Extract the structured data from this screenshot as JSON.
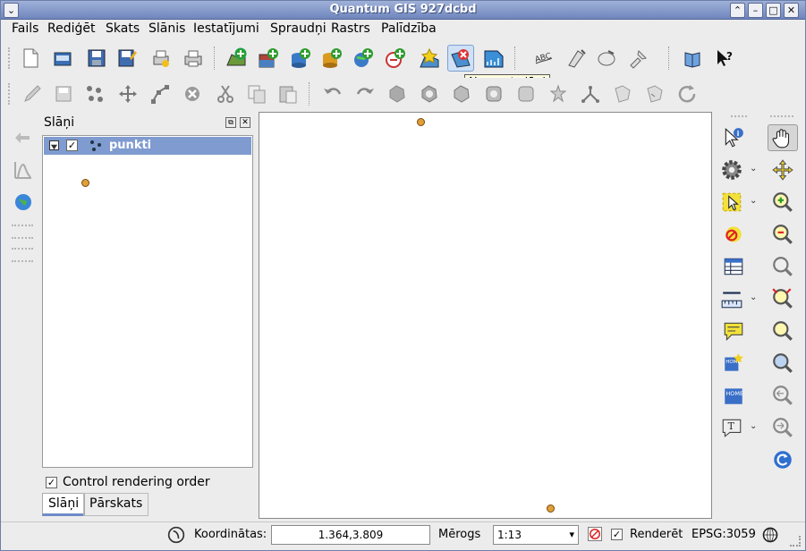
{
  "window": {
    "title": "Quantum GIS 927dcbd"
  },
  "menubar": [
    "Fails",
    "Rediģēt",
    "Skats",
    "Slānis",
    "Iestatījumi",
    "Spraudņi",
    "Rastrs",
    "Palīdzība"
  ],
  "toolbar": {
    "row1_icons": [
      "new-project-icon",
      "open-project-icon",
      "save-project-icon",
      "save-as-icon",
      "print-composer-icon",
      "print-icon",
      "add-vector-layer-icon",
      "add-raster-layer-icon",
      "add-postgis-layer-icon",
      "add-spatialite-layer-icon",
      "add-wms-layer-icon",
      "add-wfs-layer-icon",
      "new-vector-layer-icon",
      "remove-layer-icon",
      "overview-icon",
      "labeling-icon",
      "plugin-a-icon",
      "plugin-b-icon",
      "plugin-c-icon",
      "help-contents-icon",
      "whats-this-icon"
    ],
    "row2_icons": [
      "toggle-editing-icon",
      "save-edits-icon",
      "capture-point-icon",
      "move-feature-icon",
      "node-tool-icon",
      "delete-selected-icon",
      "cut-features-icon",
      "copy-features-icon",
      "paste-features-icon",
      "undo-icon",
      "redo-icon",
      "simplify-icon",
      "add-ring-icon",
      "add-part-icon",
      "delete-ring-icon",
      "delete-part-icon",
      "reshape-icon",
      "split-features-icon",
      "merge-features-icon",
      "rotate-point-icon",
      "offset-icon",
      "rotate-label-icon"
    ],
    "tooltip": "Noņemt slāni"
  },
  "layers_panel": {
    "title": "Slāņi",
    "layers": [
      {
        "name": "punkti",
        "checked": true
      }
    ],
    "control_rendering_order": "Control rendering order",
    "tabs": [
      "Slāņi",
      "Pārskats"
    ]
  },
  "right_toolbar": [
    "identify-icon",
    "pan-icon",
    "settings-icon",
    "pan-to-selection-icon",
    "select-icon",
    "zoom-in-icon",
    "deselect-icon",
    "zoom-out-icon",
    "attribute-table-icon",
    "zoom-full-icon",
    "measure-icon",
    "zoom-to-selection-icon",
    "map-tips-icon",
    "zoom-to-layer-icon",
    "new-bookmark-icon",
    "zoom-actual-icon",
    "show-bookmarks-icon",
    "zoom-last-icon",
    "text-annotation-icon",
    "zoom-next-icon",
    "refresh-icon"
  ],
  "statusbar": {
    "coords_label": "Koordinātas:",
    "coords_value": "1.364,3.809",
    "scale_label": "Mērogs",
    "scale_value": "1:13",
    "render_label": "Renderēt",
    "crs": "EPSG:3059"
  },
  "colors": {
    "titlebar": "#7f94c6",
    "selection": "#7f9bd0",
    "point": "#e0a038"
  }
}
